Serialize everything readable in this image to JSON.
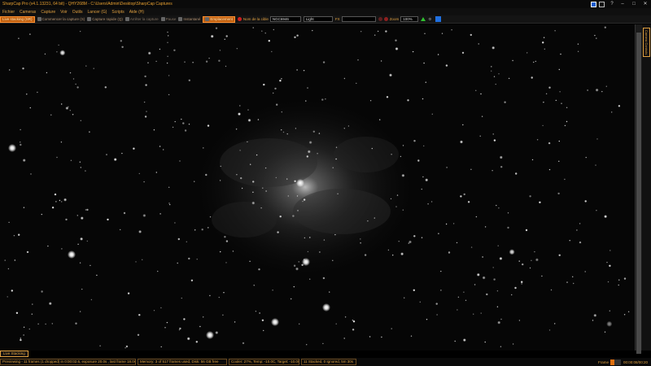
{
  "titlebar": {
    "title": "SharpCap Pro (v4.1.13231, 64 bit) - QHY268M - C:\\Users\\Admin\\Desktop\\SharpCap Captures"
  },
  "menu": {
    "items": [
      "Fichier",
      "Cameras",
      "Capture",
      "Voir",
      "Outils",
      "Lancer (G)",
      "Scripts",
      "Aide (H)"
    ]
  },
  "toolbar": {
    "live_stack": "Live stacking (SR)",
    "start_capture": "Commencer la capture (S)",
    "quick_capture": "Capture rapide (Q)",
    "stop_capture": "Arrêter la capture",
    "pause": "Pause",
    "snapshot": "Instantané",
    "framing": "Emplacement",
    "target_label": "Nom de la cible",
    "target_value": "NGC6946",
    "frame_type": "Light",
    "fx_label": "FX",
    "fx_value": "",
    "zoom_label": "Zoom",
    "zoom_value": "100%"
  },
  "side_panel": {
    "tab_label": "Camera Controls"
  },
  "live_tab": {
    "label": "Live Stacking"
  },
  "status": {
    "previewing": "Previewing - 11 frames (1 dropped) in 0:00:02.6, exposure 20.0s , last frame 18.0s",
    "memory": "Memory: 3 of 517 frames used, Disk: 56 GB free",
    "cooler": "Cooler: 27%, Temp: -10.0C, Target: -10.0C",
    "stacked": "11 Stacked, 0 Ignored, 5m 30s",
    "frame_label": "Frame",
    "frame_progress": 0.4,
    "elapsed": "00:00:08/00:20"
  },
  "colors": {
    "accent": "#e0a040",
    "active": "#c06010",
    "background": "#000000"
  }
}
